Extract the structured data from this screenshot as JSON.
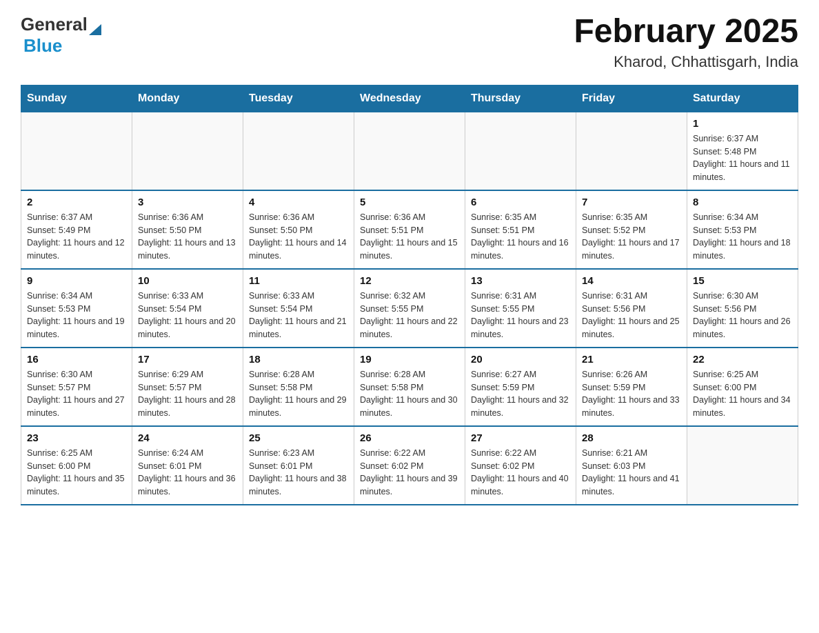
{
  "logo": {
    "general": "General",
    "blue": "Blue"
  },
  "title": "February 2025",
  "subtitle": "Kharod, Chhattisgarh, India",
  "weekdays": [
    "Sunday",
    "Monday",
    "Tuesday",
    "Wednesday",
    "Thursday",
    "Friday",
    "Saturday"
  ],
  "weeks": [
    [
      {
        "day": "",
        "info": ""
      },
      {
        "day": "",
        "info": ""
      },
      {
        "day": "",
        "info": ""
      },
      {
        "day": "",
        "info": ""
      },
      {
        "day": "",
        "info": ""
      },
      {
        "day": "",
        "info": ""
      },
      {
        "day": "1",
        "info": "Sunrise: 6:37 AM\nSunset: 5:48 PM\nDaylight: 11 hours and 11 minutes."
      }
    ],
    [
      {
        "day": "2",
        "info": "Sunrise: 6:37 AM\nSunset: 5:49 PM\nDaylight: 11 hours and 12 minutes."
      },
      {
        "day": "3",
        "info": "Sunrise: 6:36 AM\nSunset: 5:50 PM\nDaylight: 11 hours and 13 minutes."
      },
      {
        "day": "4",
        "info": "Sunrise: 6:36 AM\nSunset: 5:50 PM\nDaylight: 11 hours and 14 minutes."
      },
      {
        "day": "5",
        "info": "Sunrise: 6:36 AM\nSunset: 5:51 PM\nDaylight: 11 hours and 15 minutes."
      },
      {
        "day": "6",
        "info": "Sunrise: 6:35 AM\nSunset: 5:51 PM\nDaylight: 11 hours and 16 minutes."
      },
      {
        "day": "7",
        "info": "Sunrise: 6:35 AM\nSunset: 5:52 PM\nDaylight: 11 hours and 17 minutes."
      },
      {
        "day": "8",
        "info": "Sunrise: 6:34 AM\nSunset: 5:53 PM\nDaylight: 11 hours and 18 minutes."
      }
    ],
    [
      {
        "day": "9",
        "info": "Sunrise: 6:34 AM\nSunset: 5:53 PM\nDaylight: 11 hours and 19 minutes."
      },
      {
        "day": "10",
        "info": "Sunrise: 6:33 AM\nSunset: 5:54 PM\nDaylight: 11 hours and 20 minutes."
      },
      {
        "day": "11",
        "info": "Sunrise: 6:33 AM\nSunset: 5:54 PM\nDaylight: 11 hours and 21 minutes."
      },
      {
        "day": "12",
        "info": "Sunrise: 6:32 AM\nSunset: 5:55 PM\nDaylight: 11 hours and 22 minutes."
      },
      {
        "day": "13",
        "info": "Sunrise: 6:31 AM\nSunset: 5:55 PM\nDaylight: 11 hours and 23 minutes."
      },
      {
        "day": "14",
        "info": "Sunrise: 6:31 AM\nSunset: 5:56 PM\nDaylight: 11 hours and 25 minutes."
      },
      {
        "day": "15",
        "info": "Sunrise: 6:30 AM\nSunset: 5:56 PM\nDaylight: 11 hours and 26 minutes."
      }
    ],
    [
      {
        "day": "16",
        "info": "Sunrise: 6:30 AM\nSunset: 5:57 PM\nDaylight: 11 hours and 27 minutes."
      },
      {
        "day": "17",
        "info": "Sunrise: 6:29 AM\nSunset: 5:57 PM\nDaylight: 11 hours and 28 minutes."
      },
      {
        "day": "18",
        "info": "Sunrise: 6:28 AM\nSunset: 5:58 PM\nDaylight: 11 hours and 29 minutes."
      },
      {
        "day": "19",
        "info": "Sunrise: 6:28 AM\nSunset: 5:58 PM\nDaylight: 11 hours and 30 minutes."
      },
      {
        "day": "20",
        "info": "Sunrise: 6:27 AM\nSunset: 5:59 PM\nDaylight: 11 hours and 32 minutes."
      },
      {
        "day": "21",
        "info": "Sunrise: 6:26 AM\nSunset: 5:59 PM\nDaylight: 11 hours and 33 minutes."
      },
      {
        "day": "22",
        "info": "Sunrise: 6:25 AM\nSunset: 6:00 PM\nDaylight: 11 hours and 34 minutes."
      }
    ],
    [
      {
        "day": "23",
        "info": "Sunrise: 6:25 AM\nSunset: 6:00 PM\nDaylight: 11 hours and 35 minutes."
      },
      {
        "day": "24",
        "info": "Sunrise: 6:24 AM\nSunset: 6:01 PM\nDaylight: 11 hours and 36 minutes."
      },
      {
        "day": "25",
        "info": "Sunrise: 6:23 AM\nSunset: 6:01 PM\nDaylight: 11 hours and 38 minutes."
      },
      {
        "day": "26",
        "info": "Sunrise: 6:22 AM\nSunset: 6:02 PM\nDaylight: 11 hours and 39 minutes."
      },
      {
        "day": "27",
        "info": "Sunrise: 6:22 AM\nSunset: 6:02 PM\nDaylight: 11 hours and 40 minutes."
      },
      {
        "day": "28",
        "info": "Sunrise: 6:21 AM\nSunset: 6:03 PM\nDaylight: 11 hours and 41 minutes."
      },
      {
        "day": "",
        "info": ""
      }
    ]
  ]
}
